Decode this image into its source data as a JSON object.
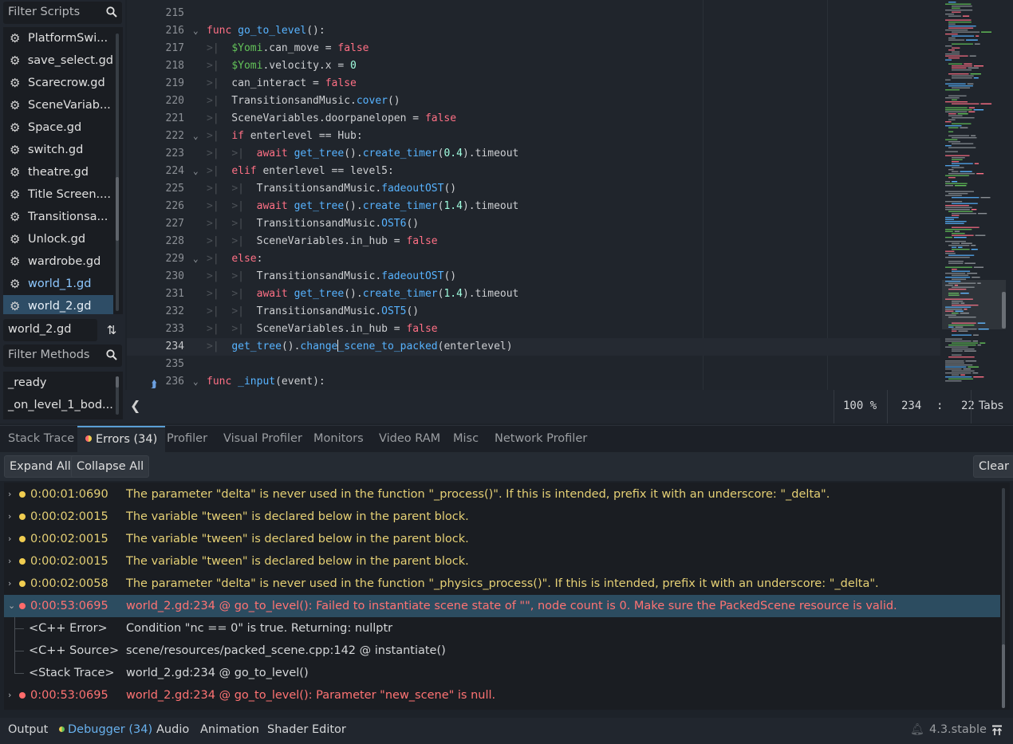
{
  "scripts_panel": {
    "filter_placeholder": "Filter Scripts",
    "items": [
      {
        "label": "PlatformSwi...",
        "state": "normal"
      },
      {
        "label": "save_select.gd",
        "state": "normal"
      },
      {
        "label": "Scarecrow.gd",
        "state": "normal"
      },
      {
        "label": "SceneVariab...",
        "state": "normal"
      },
      {
        "label": "Space.gd",
        "state": "normal"
      },
      {
        "label": "switch.gd",
        "state": "normal"
      },
      {
        "label": "theatre.gd",
        "state": "normal"
      },
      {
        "label": "Title Screen....",
        "state": "normal"
      },
      {
        "label": "Transitionsa...",
        "state": "normal"
      },
      {
        "label": "Unlock.gd",
        "state": "normal"
      },
      {
        "label": "wardrobe.gd",
        "state": "normal"
      },
      {
        "label": "world_1.gd",
        "state": "open"
      },
      {
        "label": "world_2.gd",
        "state": "selected"
      }
    ],
    "current_script": "world_2.gd",
    "methods_filter_placeholder": "Filter Methods",
    "methods": [
      "_ready",
      "_on_level_1_bod..."
    ]
  },
  "editor": {
    "lines": [
      {
        "n": "215",
        "fold": "",
        "tabs": 0,
        "code": ""
      },
      {
        "n": "216",
        "fold": "v",
        "tabs": 0,
        "code": "<span class=\"kw\">func</span> <span class=\"fn\">go_to_level</span>():"
      },
      {
        "n": "217",
        "fold": "",
        "tabs": 1,
        "code": "<span class=\"node\">$Yomi</span>.can_move = <span class=\"kw\">false</span>"
      },
      {
        "n": "218",
        "fold": "",
        "tabs": 1,
        "code": "<span class=\"node\">$Yomi</span>.velocity.x = <span class=\"num\">0</span>"
      },
      {
        "n": "219",
        "fold": "",
        "tabs": 1,
        "code": "can_interact = <span class=\"kw\">false</span>"
      },
      {
        "n": "220",
        "fold": "",
        "tabs": 1,
        "code": "TransitionsandMusic.<span class=\"fn\">cover</span>()"
      },
      {
        "n": "221",
        "fold": "",
        "tabs": 1,
        "code": "SceneVariables.doorpanelopen = <span class=\"kw\">false</span>"
      },
      {
        "n": "222",
        "fold": "v",
        "tabs": 1,
        "code": "<span class=\"kw\">if</span> enterlevel == Hub:"
      },
      {
        "n": "223",
        "fold": "",
        "tabs": 2,
        "code": "<span class=\"kw\">await</span> <span class=\"fn\">get_tree</span>().<span class=\"fn\">create_timer</span>(<span class=\"num\">0.4</span>).timeout"
      },
      {
        "n": "224",
        "fold": "v",
        "tabs": 1,
        "code": "<span class=\"kw\">elif</span> enterlevel == level5:"
      },
      {
        "n": "225",
        "fold": "",
        "tabs": 2,
        "code": "TransitionsandMusic.<span class=\"fn\">fadeoutOST</span>()"
      },
      {
        "n": "226",
        "fold": "",
        "tabs": 2,
        "code": "<span class=\"kw\">await</span> <span class=\"fn\">get_tree</span>().<span class=\"fn\">create_timer</span>(<span class=\"num\">1.4</span>).timeout"
      },
      {
        "n": "227",
        "fold": "",
        "tabs": 2,
        "code": "TransitionsandMusic.<span class=\"fn\">OST6</span>()"
      },
      {
        "n": "228",
        "fold": "",
        "tabs": 2,
        "code": "SceneVariables.in_hub = <span class=\"kw\">false</span>"
      },
      {
        "n": "229",
        "fold": "v",
        "tabs": 1,
        "code": "<span class=\"kw\">else</span>:"
      },
      {
        "n": "230",
        "fold": "",
        "tabs": 2,
        "code": "TransitionsandMusic.<span class=\"fn\">fadeoutOST</span>()"
      },
      {
        "n": "231",
        "fold": "",
        "tabs": 2,
        "code": "<span class=\"kw\">await</span> <span class=\"fn\">get_tree</span>().<span class=\"fn\">create_timer</span>(<span class=\"num\">1.4</span>).timeout"
      },
      {
        "n": "232",
        "fold": "",
        "tabs": 2,
        "code": "TransitionsandMusic.<span class=\"fn\">OST5</span>()"
      },
      {
        "n": "233",
        "fold": "",
        "tabs": 2,
        "code": "SceneVariables.in_hub = <span class=\"kw\">false</span>"
      },
      {
        "n": "234",
        "fold": "",
        "tabs": 1,
        "code": "<span class=\"fn\">get_tree</span>().<span class=\"fn\">change</span><span class=\"caret\"></span><span class=\"fn\">_scene_to_packed</span>(enterlevel)",
        "current": true
      },
      {
        "n": "235",
        "fold": "",
        "tabs": 0,
        "code": ""
      },
      {
        "n": "236",
        "fold": "v",
        "tabs": 0,
        "code": "<span class=\"kw\">func</span> <span class=\"fn\">_input</span>(event):",
        "glyph": true
      }
    ],
    "status": {
      "zoom": "100 %",
      "line": "234",
      "col": "22",
      "indent": "Tabs"
    }
  },
  "debugger": {
    "tabs": [
      {
        "label": "Stack Trace",
        "active": false
      },
      {
        "label": "Errors (34)",
        "active": true
      },
      {
        "label": "Profiler",
        "active": false
      },
      {
        "label": "Visual Profiler",
        "active": false
      },
      {
        "label": "Monitors",
        "active": false
      },
      {
        "label": "Video RAM",
        "active": false
      },
      {
        "label": "Misc",
        "active": false
      },
      {
        "label": "Network Profiler",
        "active": false
      }
    ],
    "expand_all": "Expand All",
    "collapse_all": "Collapse All",
    "clear": "Clear",
    "errors": [
      {
        "time": "0:00:01:0690",
        "type": "warning",
        "msg": "The parameter \"delta\" is never used in the function \"_process()\". If this is intended, prefix it with an underscore: \"_delta\"."
      },
      {
        "time": "0:00:02:0015",
        "type": "warning",
        "msg": "The variable \"tween\" is declared below in the parent block."
      },
      {
        "time": "0:00:02:0015",
        "type": "warning",
        "msg": "The variable \"tween\" is declared below in the parent block."
      },
      {
        "time": "0:00:02:0015",
        "type": "warning",
        "msg": "The variable \"tween\" is declared below in the parent block."
      },
      {
        "time": "0:00:02:0058",
        "type": "warning",
        "msg": "The parameter \"delta\" is never used in the function \"_physics_process()\". If this is intended, prefix it with an underscore: \"_delta\"."
      },
      {
        "time": "0:00:53:0695",
        "type": "error",
        "expanded": true,
        "msg": "world_2.gd:234 @ go_to_level(): Failed to instantiate scene state of \"\", node count is 0. Make sure the PackedScene resource is valid."
      },
      {
        "time": "0:00:53:0695",
        "type": "error",
        "msg": "world_2.gd:234 @ go_to_level(): Parameter \"new_scene\" is null."
      }
    ],
    "details": [
      {
        "label": "<C++ Error>",
        "value": "Condition \"nc == 0\" is true. Returning: nullptr"
      },
      {
        "label": "<C++ Source>",
        "value": "scene/resources/packed_scene.cpp:142 @ instantiate()"
      },
      {
        "label": "<Stack Trace>",
        "value": "world_2.gd:234 @ go_to_level()"
      }
    ]
  },
  "bottom_bar": {
    "tabs": [
      {
        "label": "Output",
        "active": false
      },
      {
        "label": "Debugger (34)",
        "active": true
      },
      {
        "label": "Audio",
        "active": false
      },
      {
        "label": "Animation",
        "active": false
      },
      {
        "label": "Shader Editor",
        "active": false
      }
    ],
    "version": "4.3.stable"
  },
  "colors": {
    "warning": "#e5d075",
    "error": "#ff7373",
    "accent": "#68b1ee",
    "selection": "#2c4c60"
  }
}
